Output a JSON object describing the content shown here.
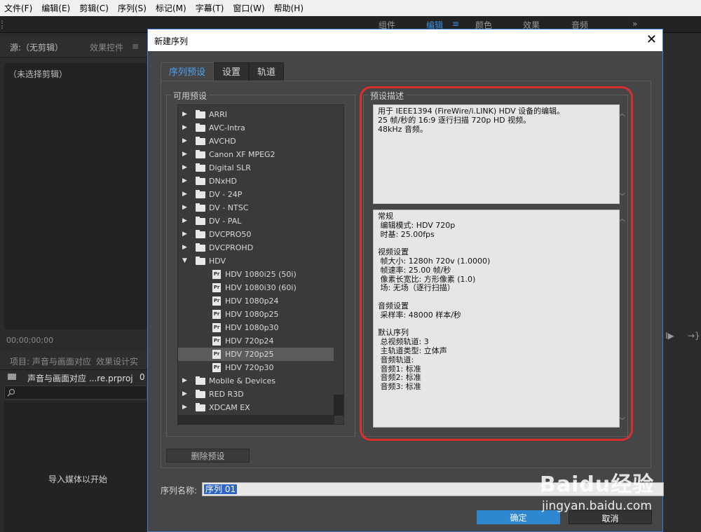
{
  "menu": [
    "文件(F)",
    "编辑(E)",
    "剪辑(C)",
    "序列(S)",
    "标记(M)",
    "字幕(T)",
    "窗口(W)",
    "帮助(H)"
  ],
  "workspaces": {
    "w1": "组件",
    "w2": "编辑",
    "w2_menu": "≡",
    "w3": "颜色",
    "w4": "效果",
    "w5": "音频",
    "more": "»"
  },
  "source_panel": {
    "tab1": "源:（无剪辑）",
    "tab2": "效果控件",
    "tab2_menu": "≡",
    "no_clip": "（未选择剪辑）",
    "timecode": "00;00;00;00"
  },
  "project_panel": {
    "tab1": "项目: 声音与画面对应",
    "tab2": "效果设计实",
    "file_name": "声音与画面对应 ...re.prproj",
    "count": "0",
    "import_hint": "导入媒体以开始"
  },
  "edge_icons": {
    "step_forward": "I▶",
    "go_to_out": "→}"
  },
  "dialog": {
    "title": "新建序列",
    "close": "✕",
    "tabs": [
      "序列预设",
      "设置",
      "轨道"
    ],
    "available_presets_label": "可用预设",
    "preset_description_label": "预设描述",
    "tree": [
      {
        "label": "ARRI",
        "kind": "folder",
        "open": false
      },
      {
        "label": "AVC-Intra",
        "kind": "folder",
        "open": false
      },
      {
        "label": "AVCHD",
        "kind": "folder",
        "open": false
      },
      {
        "label": "Canon XF MPEG2",
        "kind": "folder",
        "open": false
      },
      {
        "label": "Digital SLR",
        "kind": "folder",
        "open": false
      },
      {
        "label": "DNxHD",
        "kind": "folder",
        "open": false
      },
      {
        "label": "DV - 24P",
        "kind": "folder",
        "open": false
      },
      {
        "label": "DV - NTSC",
        "kind": "folder",
        "open": false
      },
      {
        "label": "DV - PAL",
        "kind": "folder",
        "open": false
      },
      {
        "label": "DVCPRO50",
        "kind": "folder",
        "open": false
      },
      {
        "label": "DVCPROHD",
        "kind": "folder",
        "open": false
      },
      {
        "label": "HDV",
        "kind": "folder",
        "open": true
      },
      {
        "label": "HDV 1080i25 (50i)",
        "kind": "file"
      },
      {
        "label": "HDV 1080i30 (60i)",
        "kind": "file"
      },
      {
        "label": "HDV 1080p24",
        "kind": "file"
      },
      {
        "label": "HDV 1080p25",
        "kind": "file"
      },
      {
        "label": "HDV 1080p30",
        "kind": "file"
      },
      {
        "label": "HDV 720p24",
        "kind": "file"
      },
      {
        "label": "HDV 720p25",
        "kind": "file",
        "selected": true
      },
      {
        "label": "HDV 720p30",
        "kind": "file"
      },
      {
        "label": "Mobile & Devices",
        "kind": "folder",
        "open": false
      },
      {
        "label": "RED R3D",
        "kind": "folder",
        "open": false
      },
      {
        "label": "XDCAM EX",
        "kind": "folder",
        "open": false
      }
    ],
    "description_top": "用于 IEEE1394 (FireWire/i.LINK) HDV 设备的编辑。\n25 帧/秒的 16:9 逐行扫描 720p HD 视频。\n48kHz 音频。",
    "description_detail": "常规\n 编辑模式: HDV 720p\n 时基: 25.00fps\n\n视频设置\n 帧大小: 1280h 720v (1.0000)\n 帧速率: 25.00 帧/秒\n 像素长宽比: 方形像素 (1.0)\n 场: 无场（逐行扫描）\n\n音频设置\n 采样率: 48000 样本/秒\n\n默认序列\n 总视频轨道: 3\n 主轨道类型: 立体声\n 音频轨道:\n 音频1: 标准\n 音频2: 标准\n 音频3: 标准",
    "delete_preset": "删除预设",
    "sequence_name_label": "序列名称:",
    "sequence_name": "序列 01",
    "ok": "确定",
    "cancel": "取消"
  },
  "watermark": {
    "logo": "Baidu经验",
    "url": "jingyan.baidu.com"
  }
}
